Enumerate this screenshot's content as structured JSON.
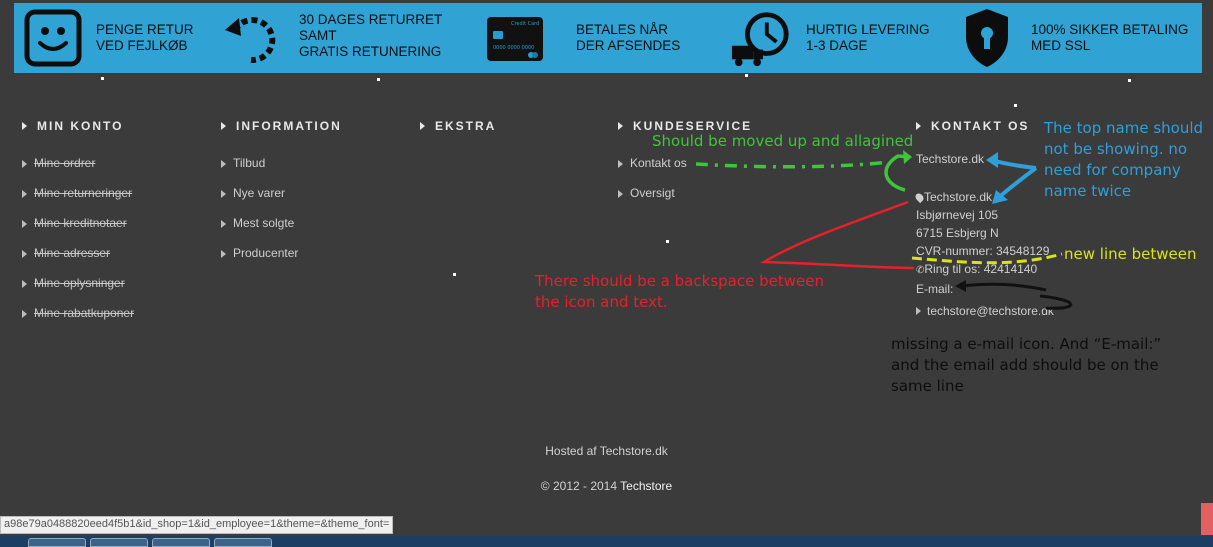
{
  "features": [
    {
      "icon": "smiley-icon",
      "lines": [
        "PENGE RETUR",
        "VED FEJLKØB"
      ]
    },
    {
      "icon": "return-arrow-icon",
      "lines": [
        "30 DAGES RETURRET",
        "SAMT",
        "GRATIS RETUNERING"
      ]
    },
    {
      "icon": "credit-card-icon",
      "lines": [
        "BETALES NÅR",
        "DER AFSENDES"
      ]
    },
    {
      "icon": "clock-truck-icon",
      "lines": [
        "HURTIG LEVERING",
        "1-3 DAGE"
      ]
    },
    {
      "icon": "shield-lock-icon",
      "lines": [
        "100% SIKKER BETALING",
        "MED SSL"
      ]
    }
  ],
  "card_texts": {
    "brand": "Credit Card",
    "number": "0000 0000 0000"
  },
  "columns": {
    "min_konto": {
      "title": "MIN KONTO",
      "items": [
        "Mine ordrer",
        "Mine returneringer",
        "Mine kreditnotaer",
        "Mine adresser",
        "Mine oplysninger",
        "Mine rabatkuponer"
      ]
    },
    "information": {
      "title": "INFORMATION",
      "items": [
        "Tilbud",
        "Nye varer",
        "Mest solgte",
        "Producenter"
      ]
    },
    "ekstra": {
      "title": "EKSTRA"
    },
    "kundeservice": {
      "title": "KUNDESERVICE",
      "items": [
        "Kontakt os",
        "Oversigt"
      ]
    },
    "kontakt": {
      "title": "KONTAKT OS",
      "company_top": "Techstore.dk",
      "address_name": "Techstore.dk,",
      "street": "Isbjørnevej 105",
      "city": "6715 Esbjerg N",
      "cvr": "CVR-nummer: 34548129",
      "phone": "Ring til os: 42414140",
      "email_label": "E-mail:",
      "email": "techstore@techstore.dk"
    }
  },
  "footer": {
    "hosted": "Hosted af Techstore.dk",
    "copyright": "© 2012 - 2014",
    "brand": "Techstore"
  },
  "annotations": {
    "green": "Should be moved up and allagined",
    "blue": [
      "The top name should",
      "not be showing. no",
      "need for company",
      "name twice"
    ],
    "yellow": "new line between",
    "red": [
      "There should be a backspace between",
      "the icon and text."
    ],
    "black": [
      "missing a e-mail icon. And “E-mail:”",
      "and the email add should be on the",
      "same line"
    ]
  },
  "status_url": "a98e79a0488820eed4f5b1&id_shop=1&id_employee=1&theme=&theme_font=",
  "colors": {
    "banner": "#30a3d4",
    "background": "#3b3b3b",
    "green": "#3fc43a",
    "blue": "#2f9fd9",
    "yellow": "#d9e21f",
    "red": "#e8202a"
  }
}
